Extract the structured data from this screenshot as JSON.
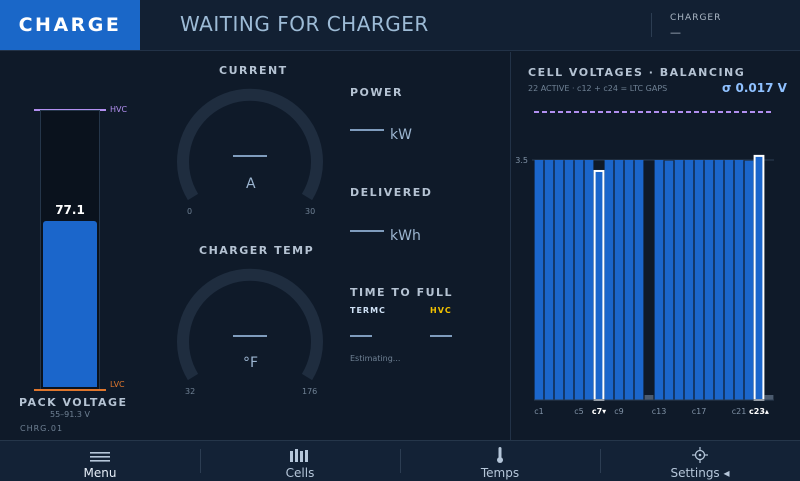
{
  "header": {
    "mode": "CHARGE",
    "status": "WAITING FOR CHARGER",
    "charger_label": "CHARGER",
    "charger_value": "—"
  },
  "pack": {
    "label": "PACK VOLTAGE",
    "range": "55–91.3 V",
    "value": "77.1",
    "hvc_label": "HVC",
    "lvc_label": "LVC",
    "fill_fraction": 0.6,
    "id": "CHRG.01"
  },
  "gauges": {
    "current": {
      "label": "CURRENT",
      "value": "—",
      "unit": "A",
      "min": "0",
      "max": "30"
    },
    "temp": {
      "label": "CHARGER TEMP",
      "value": "—",
      "unit": "°F",
      "min": "32",
      "max": "176"
    }
  },
  "stats": {
    "power": {
      "label": "POWER",
      "value": "—",
      "unit": "kW"
    },
    "delivered": {
      "label": "DELIVERED",
      "value": "—",
      "unit": "kWh"
    },
    "ttf": {
      "label": "TIME TO FULL",
      "termc_label": "TERMC",
      "hvc_label": "HVC",
      "termc_value": "—",
      "hvc_value": "—",
      "note": "Estimating..."
    }
  },
  "cells": {
    "title": "CELL VOLTAGES · BALANCING",
    "subtitle": "22 ACTIVE · c12 + c24 = LTC GAPS",
    "sigma": "σ 0.017 V",
    "ytick": "3.5",
    "xticks": [
      "c1",
      "c5",
      "c7▾",
      "c9",
      "c13",
      "c17",
      "c21",
      "c23▴"
    ],
    "colors": {
      "active": "#1b66cb",
      "gap": "#4b5b6f",
      "highlight": "#ffffff",
      "hvc": "#b28ff0"
    }
  },
  "chart_data": {
    "type": "bar",
    "categories": [
      "c1",
      "c2",
      "c3",
      "c4",
      "c5",
      "c6",
      "c7",
      "c8",
      "c9",
      "c10",
      "c11",
      "c12",
      "c13",
      "c14",
      "c15",
      "c16",
      "c17",
      "c18",
      "c19",
      "c20",
      "c21",
      "c22",
      "c23",
      "c24"
    ],
    "values": [
      3.5,
      3.5,
      3.5,
      3.5,
      3.5,
      3.5,
      3.34,
      3.5,
      3.5,
      3.5,
      3.5,
      0.1,
      3.5,
      3.49,
      3.5,
      3.5,
      3.5,
      3.5,
      3.5,
      3.5,
      3.5,
      3.49,
      3.56,
      0.1
    ],
    "min_cell": "c7",
    "max_cell": "c23",
    "ylim": [
      0,
      4.2
    ],
    "hvc_line": 4.2
  },
  "nav": {
    "items": [
      "Menu",
      "Cells",
      "Temps",
      "Settings ◂"
    ]
  }
}
